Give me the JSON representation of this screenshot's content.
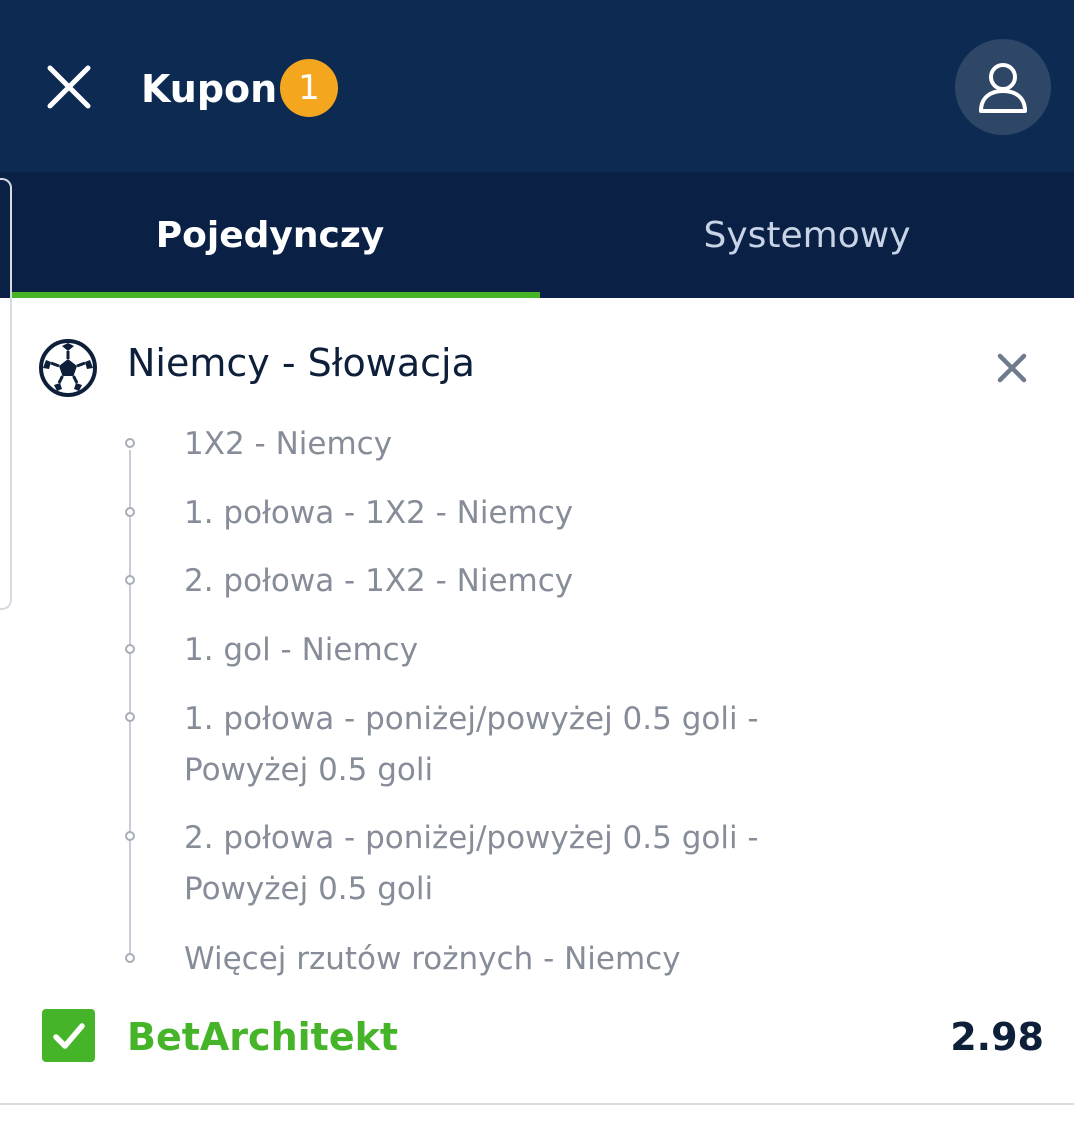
{
  "header": {
    "title": "Kupon",
    "badge_count": "1",
    "icons": {
      "close": "close-icon",
      "user": "user-icon"
    }
  },
  "tabs": [
    {
      "label": "Pojedynczy",
      "active": true
    },
    {
      "label": "Systemowy",
      "active": false
    }
  ],
  "event": {
    "icon": "football-icon",
    "title": "Niemcy - Słowacja",
    "selections": [
      "1X2 - Niemcy",
      "1. połowa - 1X2 - Niemcy",
      "2. połowa - 1X2 - Niemcy",
      "1. gol - Niemcy",
      "1. połowa - poniżej/powyżej 0.5 goli - Powyżej 0.5 goli",
      "2. połowa - poniżej/powyżej 0.5 goli - Powyżej 0.5 goli",
      "Więcej rzutów rożnych - Niemcy"
    ]
  },
  "bet_builder": {
    "label": "BetArchitekt",
    "odds": "2.98",
    "checked": true
  },
  "colors": {
    "header_bg": "#0c2a52",
    "tabs_bg": "#0a2145",
    "accent_green": "#45b429",
    "badge_orange": "#f5a61f"
  }
}
